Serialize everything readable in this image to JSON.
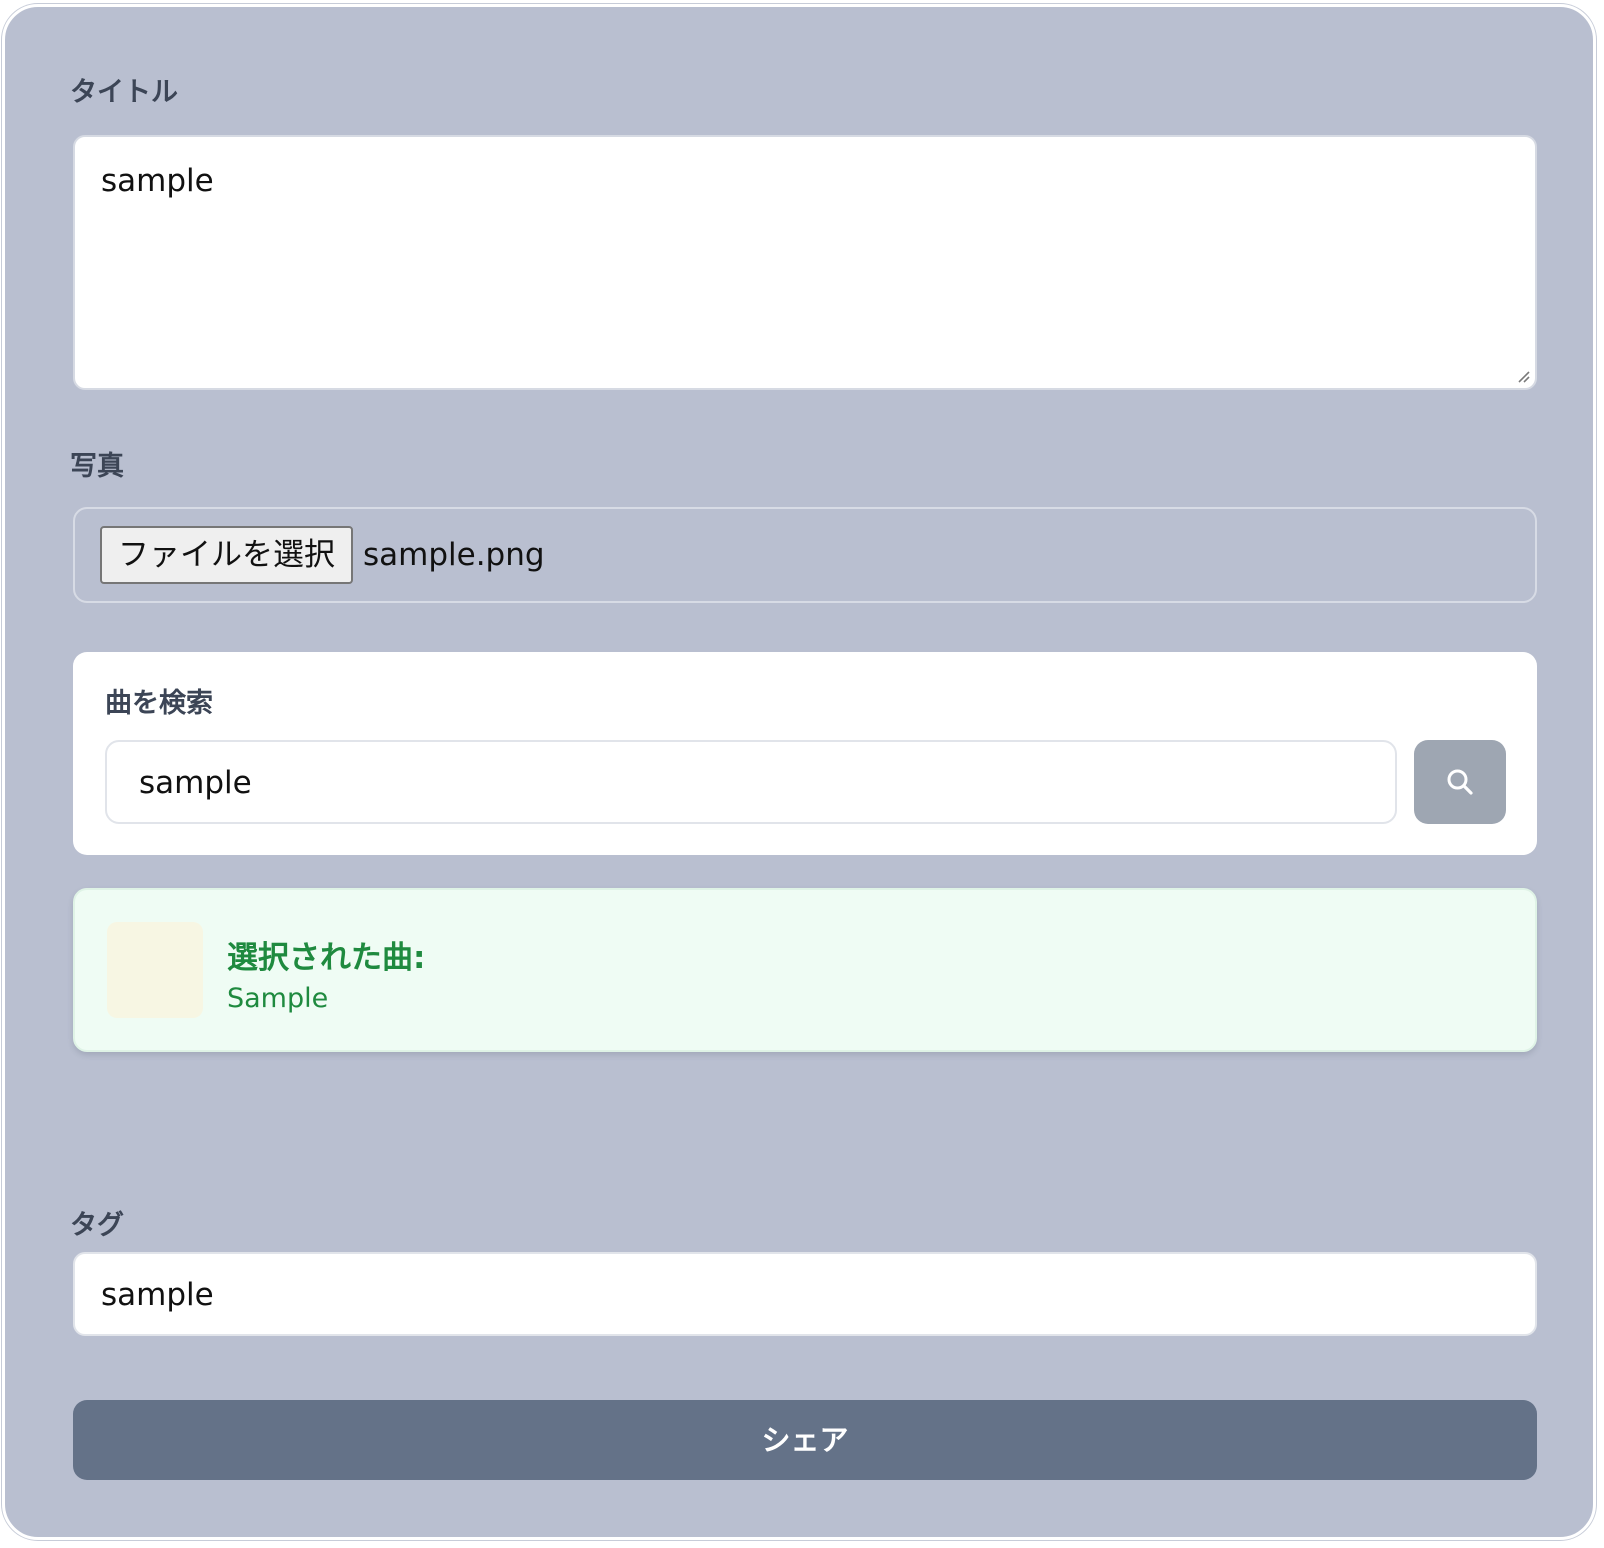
{
  "form": {
    "title_label": "タイトル",
    "title_value": "sample",
    "photo_label": "写真",
    "file_button_label": "ファイルを選択",
    "file_name": "sample.png",
    "song_search": {
      "label": "曲を検索",
      "input_value": "sample",
      "search_icon": "search-icon"
    },
    "selected_song": {
      "title": "選択された曲:",
      "name": "Sample"
    },
    "tag_label": "タグ",
    "tag_value": "sample",
    "share_button_label": "シェア"
  },
  "colors": {
    "background": "#b9bfd0",
    "share_button": "#647288",
    "search_button": "#9ea6b2",
    "selected_card_bg": "#effcf4",
    "selected_text": "#1f8a3f",
    "thumbnail": "#f7f6e3"
  }
}
